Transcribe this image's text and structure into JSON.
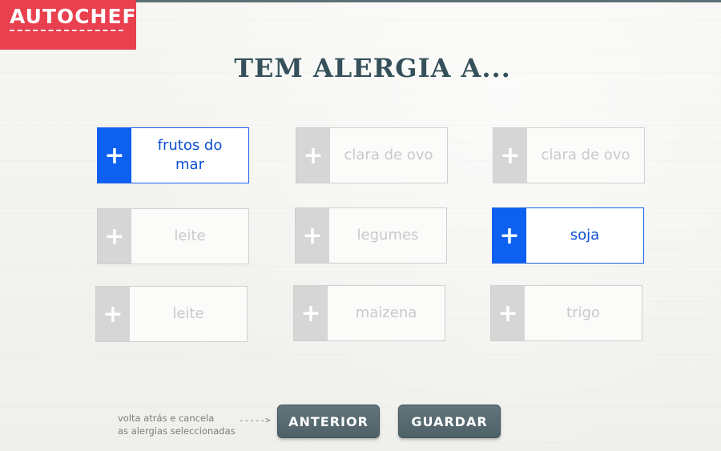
{
  "brand": {
    "logo": "AUTOCHEF"
  },
  "heading": "TEM ALERGIA A...",
  "tiles": [
    {
      "label": "frutos do mar",
      "selected": true
    },
    {
      "label": "clara de ovo",
      "selected": false
    },
    {
      "label": "clara de ovo",
      "selected": false
    },
    {
      "label": "leite",
      "selected": false
    },
    {
      "label": "legumes",
      "selected": false
    },
    {
      "label": "soja",
      "selected": true
    },
    {
      "label": "leite",
      "selected": false
    },
    {
      "label": "maizena",
      "selected": false
    },
    {
      "label": "trigo",
      "selected": false
    }
  ],
  "icons": {
    "tile_icon": "plus-icon"
  },
  "footer": {
    "hint_line1": "volta atrás e cancela",
    "hint_line2": "as alergias seleccionadas",
    "arrow": "----->",
    "back_label": "ANTERIOR",
    "save_label": "GUARDAR"
  },
  "colors": {
    "brand_red": "#e8404f",
    "accent_blue": "#0d60f0",
    "heading": "#35505a",
    "button": "#5b6e75"
  }
}
